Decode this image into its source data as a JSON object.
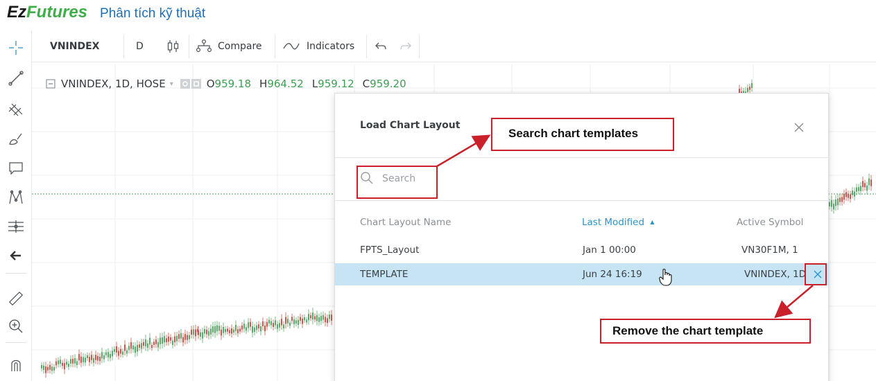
{
  "brand": {
    "part1": "Ez",
    "part2": "Futures",
    "subtitle": "Phân tích kỹ thuật"
  },
  "toolbar": {
    "symbol": "VNINDEX",
    "interval": "D",
    "compare_label": "Compare",
    "indicators_label": "Indicators"
  },
  "legend": {
    "title": "VNINDEX, 1D, HOSE",
    "open_label": "O",
    "open": "959.18",
    "high_label": "H",
    "high": "964.52",
    "low_label": "L",
    "low": "959.12",
    "close_label": "C",
    "close": "959.20"
  },
  "dialog": {
    "title": "Load Chart Layout",
    "search_placeholder": "Search",
    "columns": {
      "name": "Chart Layout Name",
      "modified": "Last Modified",
      "symbol": "Active Symbol"
    },
    "rows": [
      {
        "name": "FPTS_Layout",
        "modified": "Jan 1 00:00",
        "symbol": "VN30F1M, 1"
      },
      {
        "name": "TEMPLATE",
        "modified": "Jun 24 16:19",
        "symbol": "VNINDEX, 1D"
      }
    ]
  },
  "annotations": {
    "search_label": "Search chart templates",
    "remove_label": "Remove the chart template"
  },
  "colors": {
    "accent": "#2b95c8",
    "annotation_red": "#c9202a",
    "selected_row": "#c6e4f4",
    "brand_green": "#3fae49",
    "price_green": "#3d9e52"
  },
  "icons": [
    "crosshair-icon",
    "trend-line-icon",
    "fib-icon",
    "brush-icon",
    "comment-icon",
    "pattern-icon",
    "measure-tools-icon",
    "arrow-left-icon",
    "ruler-icon",
    "zoom-in-icon",
    "magnet-icon",
    "candles-icon",
    "compare-icon",
    "indicators-icon",
    "undo-icon",
    "redo-icon",
    "search-icon",
    "close-icon"
  ]
}
